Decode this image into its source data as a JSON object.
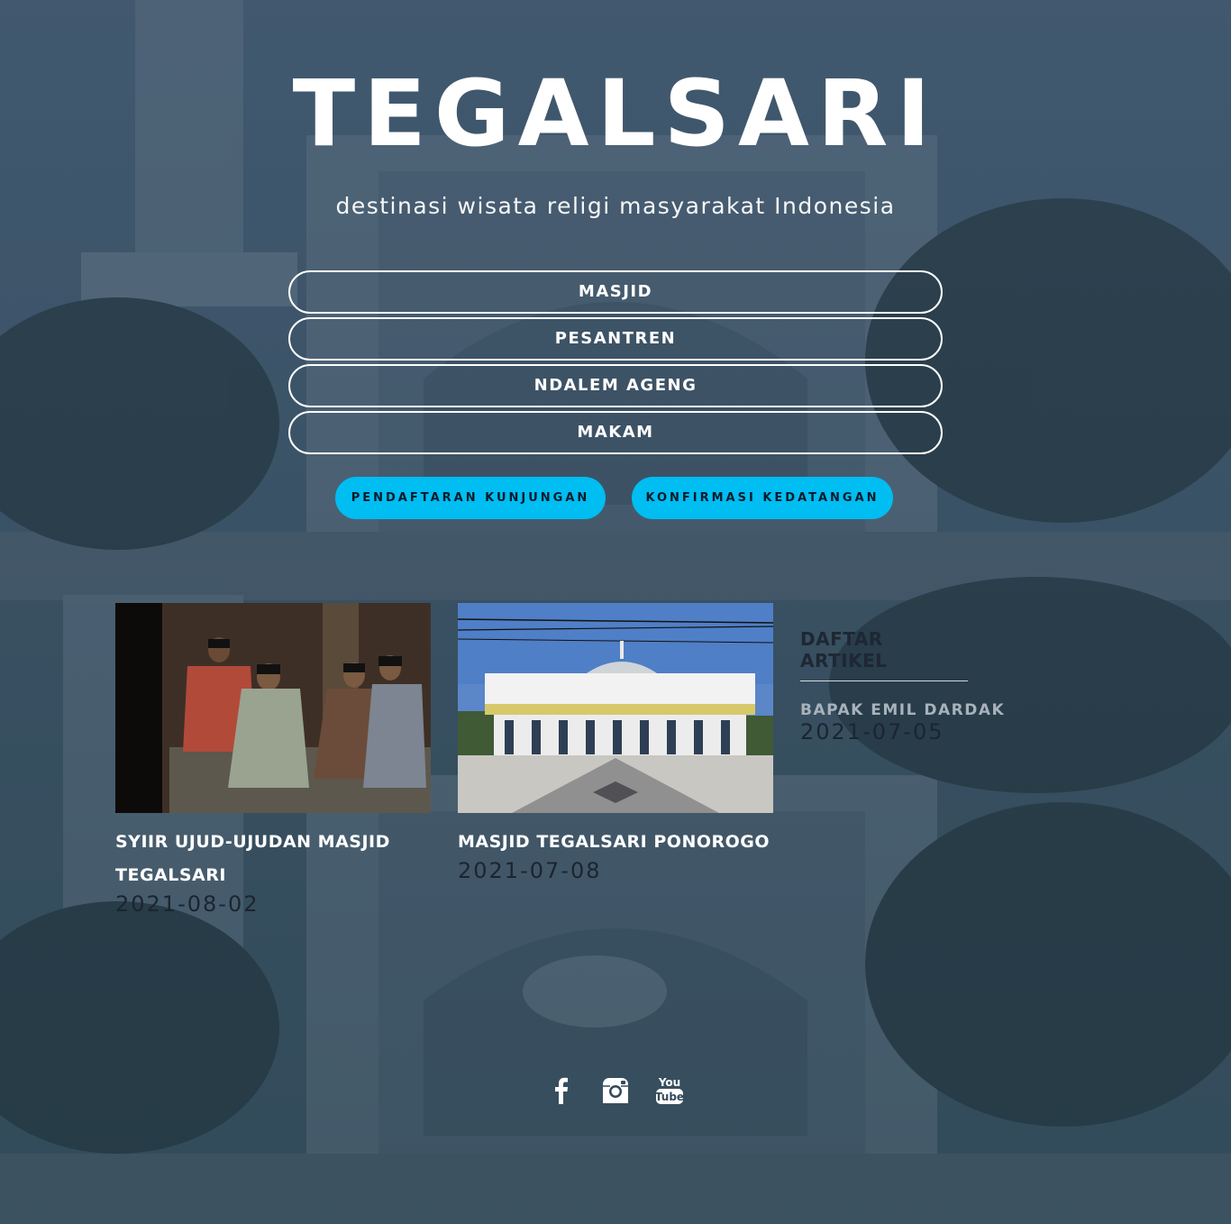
{
  "header": {
    "title": "TEGALSARI",
    "tagline": "destinasi wisata religi masyarakat Indonesia"
  },
  "menu": {
    "items": [
      {
        "label": "MASJID"
      },
      {
        "label": "PESANTREN"
      },
      {
        "label": "NDALEM AGENG"
      },
      {
        "label": "MAKAM"
      }
    ]
  },
  "actions": {
    "registration_label": "PENDAFTARAN KUNJUNGAN",
    "confirmation_label": "KONFIRMASI KEDATANGAN",
    "accent_color": "#00bdf2"
  },
  "articles": [
    {
      "title": "SYIIR UJUD-UJUDAN MASJID TEGALSARI",
      "date": "2021-08-02"
    },
    {
      "title": "MASJID TEGALSARI PONOROGO",
      "date": "2021-07-08"
    }
  ],
  "sidebar": {
    "heading": "DAFTAR ARTIKEL",
    "items": [
      {
        "title": "BAPAK EMIL DARDAK",
        "date": "2021-07-05"
      }
    ]
  },
  "social": {
    "icons": [
      "facebook-icon",
      "instagram-icon",
      "youtube-icon"
    ],
    "youtube_you": "You",
    "youtube_tube": "Tube"
  }
}
